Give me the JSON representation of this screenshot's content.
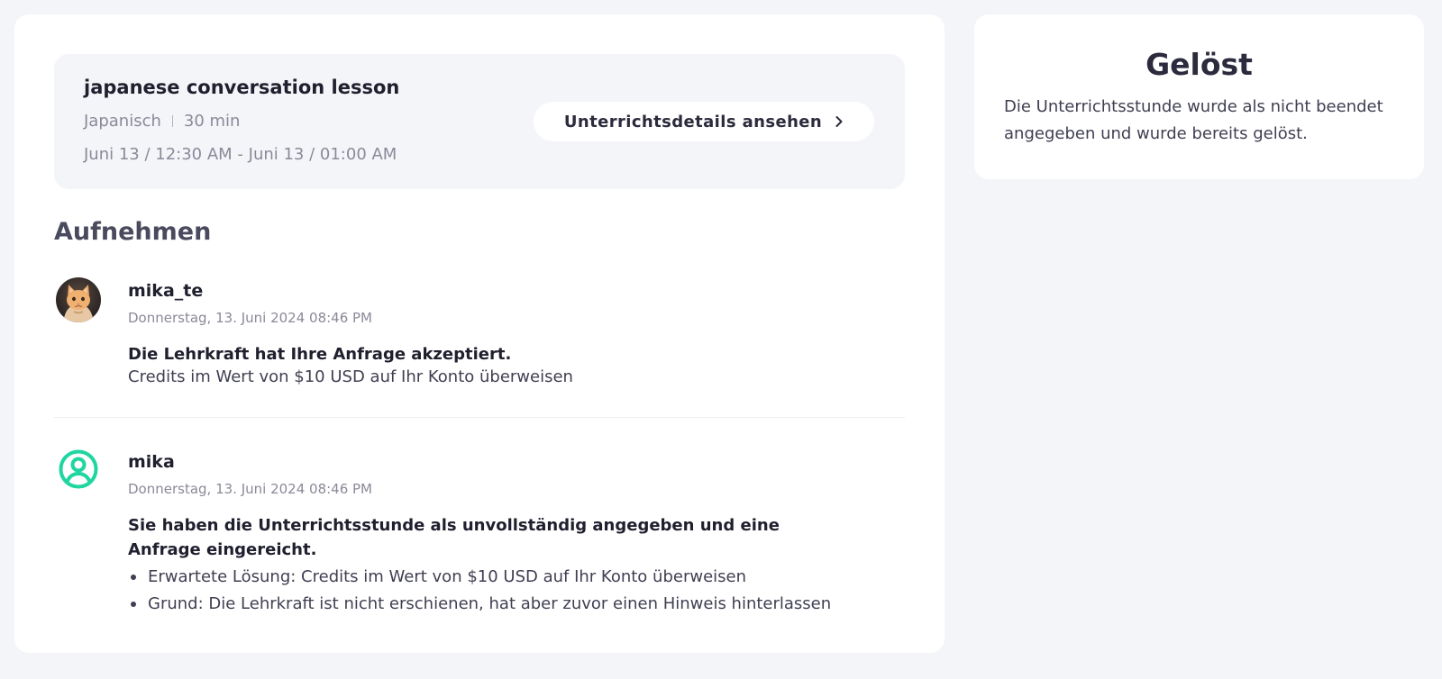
{
  "lesson": {
    "title": "japanese conversation lesson",
    "language": "Japanisch",
    "duration": "30 min",
    "time_range": "Juni 13 / 12:30 AM - Juni 13 / 01:00 AM",
    "details_button_label": "Unterrichtsdetails ansehen",
    "details_button_icon": "chevron-right-icon"
  },
  "record": {
    "heading": "Aufnehmen",
    "entries": [
      {
        "name": "mika_te",
        "avatar_icon": "cat-photo-avatar",
        "date": "Donnerstag, 13. Juni 2024 08:46 PM",
        "headline": "Die Lehrkraft hat Ihre Anfrage akzeptiert.",
        "body": "Credits im Wert von $10 USD auf Ihr Konto überweisen"
      },
      {
        "name": "mika",
        "avatar_icon": "user-circle-icon",
        "avatar_color": "#1fd6a0",
        "date": "Donnerstag, 13. Juni 2024 08:46 PM",
        "headline": "Sie haben die Unterrichtsstunde als unvollständig angegeben und eine Anfrage eingereicht.",
        "bullets": [
          "Erwartete Lösung: Credits im Wert von $10 USD auf Ihr Konto überweisen",
          "Grund: Die Lehrkraft ist nicht erschienen, hat aber zuvor einen Hinweis hinterlassen"
        ]
      }
    ]
  },
  "status": {
    "title": "Gelöst",
    "description": "Die Unterrichtsstunde wurde als nicht beendet angegeben und wurde bereits gelöst."
  }
}
